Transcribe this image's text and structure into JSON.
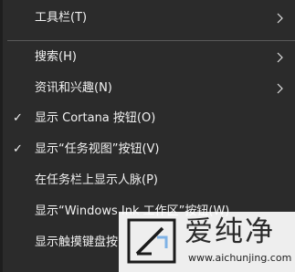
{
  "menu": {
    "items": [
      {
        "label": "工具栏(T)",
        "checked": false,
        "submenu": true
      },
      {
        "label": "搜索(H)",
        "checked": false,
        "submenu": true
      },
      {
        "label": "资讯和兴趣(N)",
        "checked": false,
        "submenu": true
      },
      {
        "label": "显示 Cortana 按钮(O)",
        "checked": true,
        "submenu": false
      },
      {
        "label": "显示“任务视图”按钮(V)",
        "checked": true,
        "submenu": false
      },
      {
        "label": "在任务栏上显示人脉(P)",
        "checked": false,
        "submenu": false
      },
      {
        "label": "显示“Windows Ink 工作区”按钮(W)",
        "checked": false,
        "submenu": false
      },
      {
        "label": "显示触摸键盘按",
        "checked": false,
        "submenu": false
      }
    ],
    "check_glyph": "✓",
    "colors": {
      "background": "#2b2b2b",
      "text": "#f2f2f2",
      "separator": "#5a5a5a"
    }
  },
  "watermark": {
    "title": "爱纯净",
    "url": "www.aichunjing.com"
  }
}
